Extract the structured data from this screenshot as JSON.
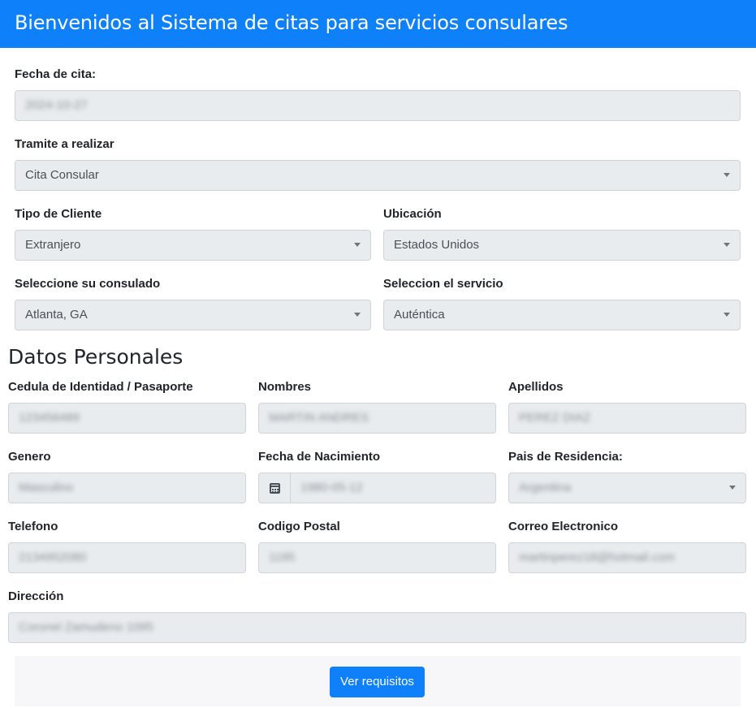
{
  "header": {
    "title": "Bienvenidos al Sistema de citas para servicios consulares"
  },
  "cita": {
    "fecha": {
      "label": "Fecha de cita:",
      "value": "2024-10-27"
    },
    "tramite": {
      "label": "Tramite a realizar",
      "value": "Cita Consular"
    },
    "tipo_cliente": {
      "label": "Tipo de Cliente",
      "value": "Extranjero"
    },
    "ubicacion": {
      "label": "Ubicación",
      "value": "Estados Unidos"
    },
    "consulado": {
      "label": "Seleccione su consulado",
      "value": "Atlanta, GA"
    },
    "servicio": {
      "label": "Seleccion el servicio",
      "value": "Auténtica"
    }
  },
  "personales": {
    "title": "Datos Personales",
    "cedula": {
      "label": "Cedula de Identidad / Pasaporte",
      "value": "123456489"
    },
    "nombres": {
      "label": "Nombres",
      "value": "MARTIN ANDRES"
    },
    "apellidos": {
      "label": "Apellidos",
      "value": "PEREZ DIAZ"
    },
    "genero": {
      "label": "Genero",
      "value": "Masculino"
    },
    "nacimiento": {
      "label": "Fecha de Nacimiento",
      "value": "1980-05-12"
    },
    "pais": {
      "label": "Pais de Residencia:",
      "value": "Argentina"
    },
    "telefono": {
      "label": "Telefono",
      "value": "2134952080"
    },
    "postal": {
      "label": "Codigo Postal",
      "value": "1195"
    },
    "correo": {
      "label": "Correo Electronico",
      "value": "martinperez18@hotmail.com"
    },
    "direccion": {
      "label": "Dirección",
      "value": "Coronel Zamudeno 1095"
    }
  },
  "actions": {
    "ver_requisitos": "Ver requisitos"
  },
  "icons": {
    "calendar": "calendar-icon",
    "dropdown": "chevron-down-icon"
  },
  "colors": {
    "primary": "#0d80fa",
    "field_bg": "#e9ecef",
    "footer_bg": "#f7f7f9"
  }
}
